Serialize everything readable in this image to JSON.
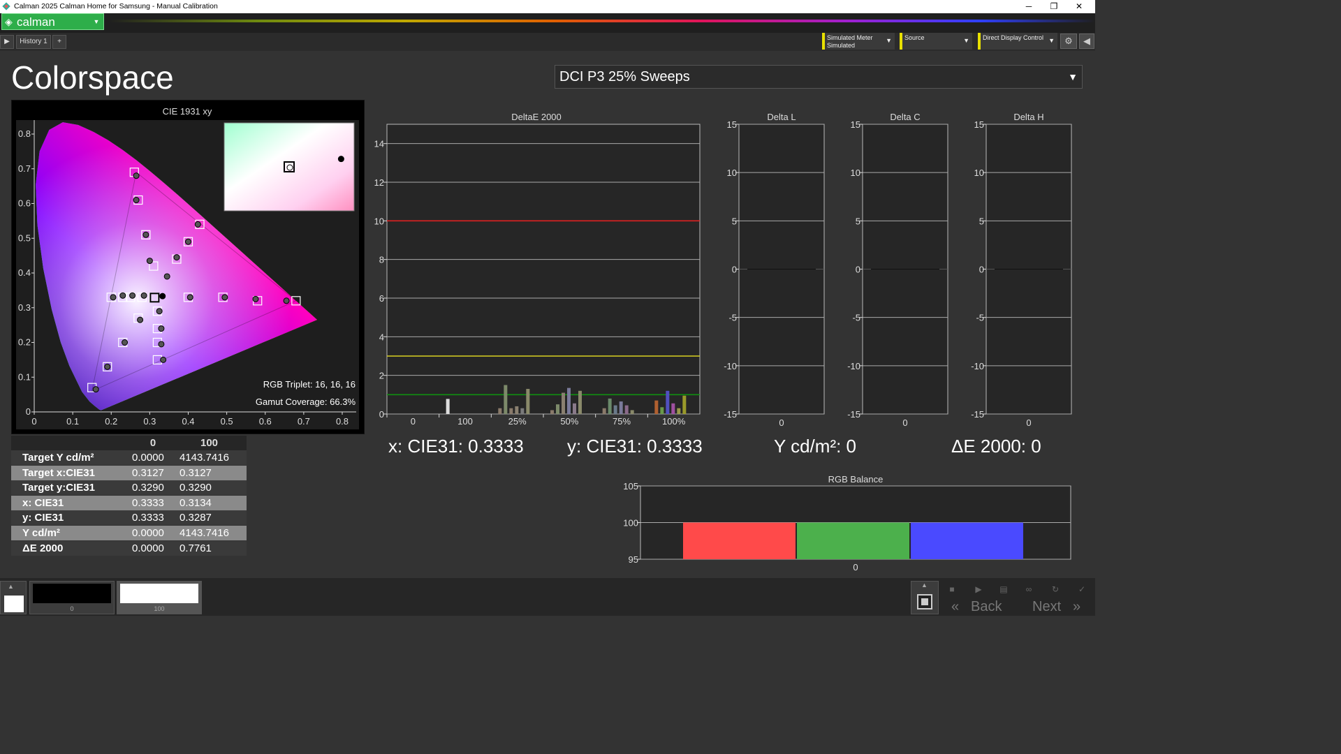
{
  "window": {
    "title": "Calman 2025 Calman Home for Samsung  - Manual Calibration",
    "minimize": "─",
    "restore": "❐",
    "close": "✕"
  },
  "brand": {
    "logo_text": "calman",
    "accent": "#2eae4a"
  },
  "tabs": {
    "play": "▶",
    "history": "History 1",
    "add": "+"
  },
  "devices": {
    "meter": {
      "line1": "Simulated Meter",
      "line2": "Simulated"
    },
    "source": {
      "line1": "Source",
      "line2": ""
    },
    "display": {
      "line1": "Direct Display Control",
      "line2": ""
    },
    "settings_icon": "gear-icon",
    "collapse_icon": "arrow-left-icon"
  },
  "page": {
    "title": "Colorspace",
    "workflow": "DCI P3 25% Sweeps"
  },
  "cie": {
    "title": "CIE 1931 xy",
    "rgb_triplet": "RGB Triplet: 16, 16, 16",
    "gamut_coverage": "Gamut Coverage: 66.3%",
    "x_ticks": [
      "0",
      "0.1",
      "0.2",
      "0.3",
      "0.4",
      "0.5",
      "0.6",
      "0.7",
      "0.8"
    ],
    "y_ticks": [
      "0",
      "0.1",
      "0.2",
      "0.3",
      "0.4",
      "0.5",
      "0.6",
      "0.7",
      "0.8"
    ],
    "targets": [
      [
        0.26,
        0.69
      ],
      [
        0.27,
        0.61
      ],
      [
        0.29,
        0.51
      ],
      [
        0.31,
        0.42
      ],
      [
        0.43,
        0.54
      ],
      [
        0.4,
        0.49
      ],
      [
        0.37,
        0.44
      ],
      [
        0.2,
        0.33
      ],
      [
        0.23,
        0.33
      ],
      [
        0.25,
        0.33
      ],
      [
        0.28,
        0.33
      ],
      [
        0.31,
        0.33
      ],
      [
        0.4,
        0.33
      ],
      [
        0.49,
        0.33
      ],
      [
        0.58,
        0.32
      ],
      [
        0.68,
        0.32
      ],
      [
        0.32,
        0.29
      ],
      [
        0.27,
        0.27
      ],
      [
        0.32,
        0.24
      ],
      [
        0.23,
        0.2
      ],
      [
        0.32,
        0.2
      ],
      [
        0.32,
        0.15
      ],
      [
        0.19,
        0.13
      ],
      [
        0.15,
        0.07
      ]
    ],
    "measured": [
      [
        0.265,
        0.68
      ],
      [
        0.265,
        0.61
      ],
      [
        0.29,
        0.51
      ],
      [
        0.3,
        0.435
      ],
      [
        0.425,
        0.54
      ],
      [
        0.4,
        0.49
      ],
      [
        0.37,
        0.445
      ],
      [
        0.345,
        0.39
      ],
      [
        0.205,
        0.33
      ],
      [
        0.23,
        0.335
      ],
      [
        0.255,
        0.335
      ],
      [
        0.285,
        0.335
      ],
      [
        0.3333,
        0.3333
      ],
      [
        0.405,
        0.33
      ],
      [
        0.495,
        0.33
      ],
      [
        0.575,
        0.325
      ],
      [
        0.655,
        0.32
      ],
      [
        0.325,
        0.29
      ],
      [
        0.275,
        0.265
      ],
      [
        0.33,
        0.24
      ],
      [
        0.235,
        0.2
      ],
      [
        0.33,
        0.195
      ],
      [
        0.335,
        0.15
      ],
      [
        0.19,
        0.13
      ],
      [
        0.16,
        0.065
      ]
    ],
    "inset_target": [
      0.5,
      0.5
    ],
    "inset_measured": [
      0.9,
      0.41
    ]
  },
  "table": {
    "headers": [
      "",
      "0",
      "100"
    ],
    "rows": [
      {
        "label": "Target Y cd/m²",
        "v0": "0.0000",
        "v100": "4143.7416"
      },
      {
        "label": "Target x:CIE31",
        "v0": "0.3127",
        "v100": "0.3127"
      },
      {
        "label": "Target y:CIE31",
        "v0": "0.3290",
        "v100": "0.3290"
      },
      {
        "label": "x: CIE31",
        "v0": "0.3333",
        "v100": "0.3134"
      },
      {
        "label": "y: CIE31",
        "v0": "0.3333",
        "v100": "0.3287"
      },
      {
        "label": "Y cd/m²",
        "v0": "0.0000",
        "v100": "4143.7416"
      },
      {
        "label": "ΔE 2000",
        "v0": "0.0000",
        "v100": "0.7761"
      }
    ]
  },
  "deltae": {
    "title": "DeltaE 2000",
    "y_ticks": [
      "0",
      "2",
      "4",
      "6",
      "8",
      "10",
      "12",
      "14"
    ],
    "x_labels": [
      "0",
      "100",
      "25%",
      "50%",
      "75%",
      "100%"
    ],
    "thresholds": [
      {
        "value": 10,
        "color": "#e02020"
      },
      {
        "value": 3,
        "color": "#d8d020"
      },
      {
        "value": 1,
        "color": "#109010"
      }
    ],
    "bars": [
      {
        "cat": 1,
        "offset": 0,
        "value": 0.78,
        "color": "#dddddd"
      },
      {
        "cat": 2,
        "offset": 0,
        "value": 0.3,
        "color": "#8a7a6a"
      },
      {
        "cat": 2,
        "offset": 1,
        "value": 1.5,
        "color": "#7d8a6a"
      },
      {
        "cat": 2,
        "offset": 2,
        "value": 0.3,
        "color": "#8a7a6a"
      },
      {
        "cat": 2,
        "offset": 3,
        "value": 0.4,
        "color": "#8a8070"
      },
      {
        "cat": 2,
        "offset": 4,
        "value": 0.3,
        "color": "#7a7a7a"
      },
      {
        "cat": 2,
        "offset": 5,
        "value": 1.3,
        "color": "#8a8a6a"
      },
      {
        "cat": 3,
        "offset": 0,
        "value": 0.2,
        "color": "#8a7a6a"
      },
      {
        "cat": 3,
        "offset": 1,
        "value": 0.5,
        "color": "#7d8a6a"
      },
      {
        "cat": 3,
        "offset": 2,
        "value": 1.1,
        "color": "#8a8070"
      },
      {
        "cat": 3,
        "offset": 3,
        "value": 1.35,
        "color": "#7a7a9a"
      },
      {
        "cat": 3,
        "offset": 4,
        "value": 0.55,
        "color": "#8a7a8a"
      },
      {
        "cat": 3,
        "offset": 5,
        "value": 1.2,
        "color": "#8a8a6a"
      },
      {
        "cat": 4,
        "offset": 0,
        "value": 0.3,
        "color": "#8a7a6a"
      },
      {
        "cat": 4,
        "offset": 1,
        "value": 0.8,
        "color": "#6a8a6a"
      },
      {
        "cat": 4,
        "offset": 2,
        "value": 0.45,
        "color": "#6a7a8a"
      },
      {
        "cat": 4,
        "offset": 3,
        "value": 0.65,
        "color": "#7a7a9a"
      },
      {
        "cat": 4,
        "offset": 4,
        "value": 0.45,
        "color": "#8a6a8a"
      },
      {
        "cat": 4,
        "offset": 5,
        "value": 0.2,
        "color": "#8a8a6a"
      },
      {
        "cat": 5,
        "offset": 0,
        "value": 0.7,
        "color": "#b06030"
      },
      {
        "cat": 5,
        "offset": 1,
        "value": 0.35,
        "color": "#6a9a4a"
      },
      {
        "cat": 5,
        "offset": 2,
        "value": 1.2,
        "color": "#5050c0"
      },
      {
        "cat": 5,
        "offset": 3,
        "value": 0.55,
        "color": "#a050a0"
      },
      {
        "cat": 5,
        "offset": 4,
        "value": 0.3,
        "color": "#9a9a4a"
      },
      {
        "cat": 5,
        "offset": 5,
        "value": 0.95,
        "color": "#9a9a2a"
      }
    ]
  },
  "delta_l": {
    "title": "Delta L",
    "y_ticks": [
      "15",
      "10",
      "5",
      "0",
      "-5",
      "-10",
      "-15"
    ],
    "x_label": "0",
    "value": 0
  },
  "delta_c": {
    "title": "Delta C",
    "y_ticks": [
      "15",
      "10",
      "5",
      "0",
      "-5",
      "-10",
      "-15"
    ],
    "x_label": "0",
    "value": 0
  },
  "delta_h": {
    "title": "Delta H",
    "y_ticks": [
      "15",
      "10",
      "5",
      "0",
      "-5",
      "-10",
      "-15"
    ],
    "x_label": "0",
    "value": 0
  },
  "readouts": {
    "x": "x: CIE31: 0.3333",
    "y": "y: CIE31: 0.3333",
    "Y": "Y cd/m²: 0",
    "de": "ΔE 2000: 0"
  },
  "rgb_balance": {
    "title": "RGB Balance",
    "y_ticks": [
      "105",
      "100",
      "95"
    ],
    "x_label": "0",
    "ylim": [
      95,
      105
    ],
    "values": [
      {
        "channel": "R",
        "value": 100,
        "color": "#ff4a4a"
      },
      {
        "channel": "G",
        "value": 100,
        "color": "#4cb04c"
      },
      {
        "channel": "B",
        "value": 100,
        "color": "#4a4aff"
      }
    ]
  },
  "bottom": {
    "swatches": [
      {
        "label": "0",
        "color": "#000000"
      },
      {
        "label": "100",
        "color": "#ffffff"
      }
    ],
    "back": "Back",
    "next": "Next"
  }
}
